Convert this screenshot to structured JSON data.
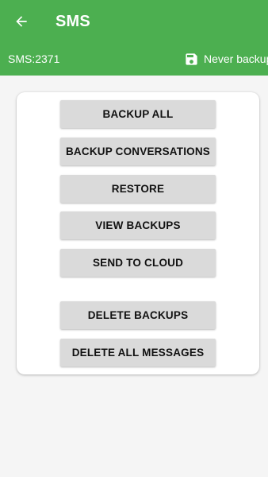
{
  "header": {
    "title": "SMS",
    "back_icon": "back-arrow-icon",
    "count_text": "SMS:2371",
    "backup_status_icon": "floppy-disk-icon",
    "backup_status_text": "Never backup"
  },
  "colors": {
    "app_bar": "#4caf50",
    "button_bg": "#dadada",
    "page_bg": "#f5f5f5"
  },
  "actions": {
    "backup_all": "BACKUP ALL",
    "backup_conversations": "BACKUP CONVERSATIONS",
    "restore": "RESTORE",
    "view_backups": "VIEW BACKUPS",
    "send_to_cloud": "SEND TO CLOUD",
    "delete_backups": "DELETE BACKUPS",
    "delete_all_messages": "DELETE ALL MESSAGES"
  }
}
